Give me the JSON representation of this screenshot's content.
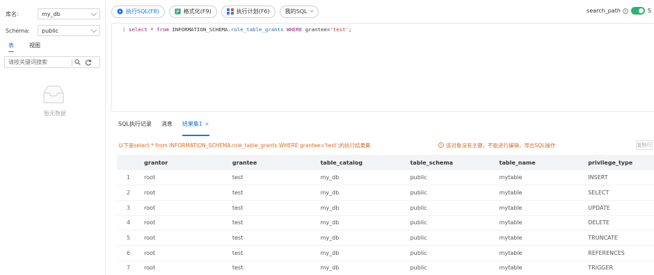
{
  "sidebar": {
    "db_label": "库名:",
    "db_value": "my_db",
    "schema_label": "Schema:",
    "schema_value": "public",
    "tabs": [
      {
        "label": "表"
      },
      {
        "label": "视图"
      }
    ],
    "search_placeholder": "请按关键词搜索",
    "empty_text": "暂无数据"
  },
  "toolbar": {
    "run_label": "执行SQL(F8)",
    "format_label": "格式化(F9)",
    "plan_label": "执行计划(F6)",
    "mysql_label": "我的SQL",
    "search_path_label": "search_path",
    "tail_label": "S"
  },
  "editor": {
    "line_number": "1",
    "sql": "select * from INFORMATION_SCHEMA.role_table_grants WHERE grantee='test';"
  },
  "result_tabs": {
    "history": "SQL执行记录",
    "messages": "消息",
    "result": "结果集1"
  },
  "result_info": {
    "summary": "以下是select * from INFORMATION_SCHEMA.role_table_grants WHERE grantee='test';的执行结果集",
    "warning": "该对象没有主键，不能进行编辑、导出SQL操作",
    "button": "复制行"
  },
  "table": {
    "columns": [
      "",
      "grantor",
      "grantee",
      "table_catalog",
      "table_schema",
      "table_name",
      "privilege_type"
    ],
    "rows": [
      [
        "1",
        "root",
        "test",
        "my_db",
        "public",
        "mytable",
        "INSERT"
      ],
      [
        "2",
        "root",
        "test",
        "my_db",
        "public",
        "mytable",
        "SELECT"
      ],
      [
        "3",
        "root",
        "test",
        "my_db",
        "public",
        "mytable",
        "UPDATE"
      ],
      [
        "4",
        "root",
        "test",
        "my_db",
        "public",
        "mytable",
        "DELETE"
      ],
      [
        "5",
        "root",
        "test",
        "my_db",
        "public",
        "mytable",
        "TRUNCATE"
      ],
      [
        "6",
        "root",
        "test",
        "my_db",
        "public",
        "mytable",
        "REFERENCES"
      ],
      [
        "7",
        "root",
        "test",
        "my_db",
        "public",
        "mytable",
        "TRIGGER"
      ]
    ]
  },
  "colors": {
    "accent": "#1a73e8",
    "warning": "#e06a1b",
    "toggle_on": "#2db36f"
  },
  "icons": [
    "chevron-down-icon",
    "search-icon",
    "refresh-icon",
    "empty-box-icon",
    "run-icon",
    "format-icon",
    "plan-icon",
    "help-icon",
    "warning-icon",
    "close-icon"
  ]
}
